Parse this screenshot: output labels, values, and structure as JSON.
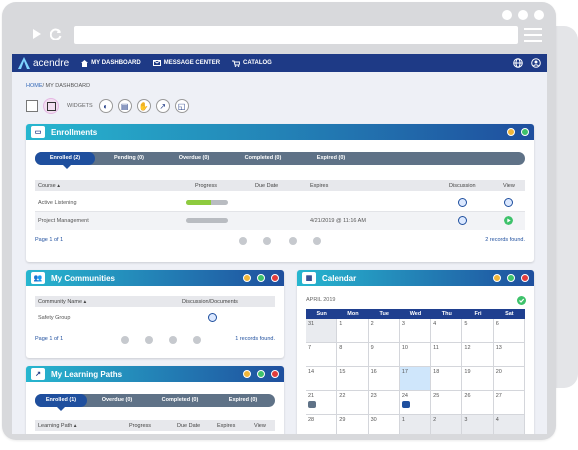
{
  "nav": {
    "brand": "acendre",
    "items": [
      {
        "label": "MY DASHBOARD",
        "icon": "home-icon"
      },
      {
        "label": "MESSAGE CENTER",
        "icon": "mail-icon"
      },
      {
        "label": "CATALOG",
        "icon": "cart-icon"
      }
    ]
  },
  "breadcrumb": {
    "home": "HOME",
    "current": "/ MY DASHBOARD"
  },
  "widgets": {
    "label": "WIDGETS"
  },
  "enrollments": {
    "title": "Enrollments",
    "tabs": [
      "Enrolled (2)",
      "Pending (0)",
      "Overdue (0)",
      "Completed (0)",
      "Expired (0)"
    ],
    "columns": [
      "Course",
      "Progress",
      "Due Date",
      "Expires",
      "Discussion",
      "View"
    ],
    "rows": [
      {
        "course": "Active Listening",
        "progress": 0.6,
        "due": "",
        "expires": ""
      },
      {
        "course": "Project Management",
        "progress": 0.0,
        "due": "",
        "expires": "4/21/2019 @ 11:16 AM"
      }
    ],
    "page": "Page 1 of 1",
    "count": "2 records found."
  },
  "communities": {
    "title": "My Communities",
    "columns": [
      "Community Name",
      "Discussion/Documents"
    ],
    "rows": [
      {
        "name": "Safety Group"
      }
    ],
    "page": "Page 1 of 1",
    "count": "1 records found."
  },
  "paths": {
    "title": "My Learning Paths",
    "tabs": [
      "Enrolled (1)",
      "Overdue (0)",
      "Completed (0)",
      "Expired (0)"
    ],
    "columns": [
      "Learning Path",
      "Progress",
      "Due Date",
      "Expires",
      "View"
    ]
  },
  "calendar": {
    "title": "Calendar",
    "month": "APRIL 2019",
    "days": [
      "Sun",
      "Mon",
      "Tue",
      "Wed",
      "Thu",
      "Fri",
      "Sat"
    ],
    "weeks": [
      [
        "31",
        "1",
        "2",
        "3",
        "4",
        "5",
        "6"
      ],
      [
        "7",
        "8",
        "9",
        "10",
        "11",
        "12",
        "13"
      ],
      [
        "14",
        "15",
        "16",
        "17",
        "18",
        "19",
        "20"
      ],
      [
        "21",
        "22",
        "23",
        "24",
        "25",
        "26",
        "27"
      ],
      [
        "28",
        "29",
        "30",
        "1",
        "2",
        "3",
        "4"
      ]
    ],
    "today": "17"
  },
  "colors": {
    "nav": "#1e3a86",
    "accent": "#27b6cf",
    "progress": "#8ecb3e"
  }
}
